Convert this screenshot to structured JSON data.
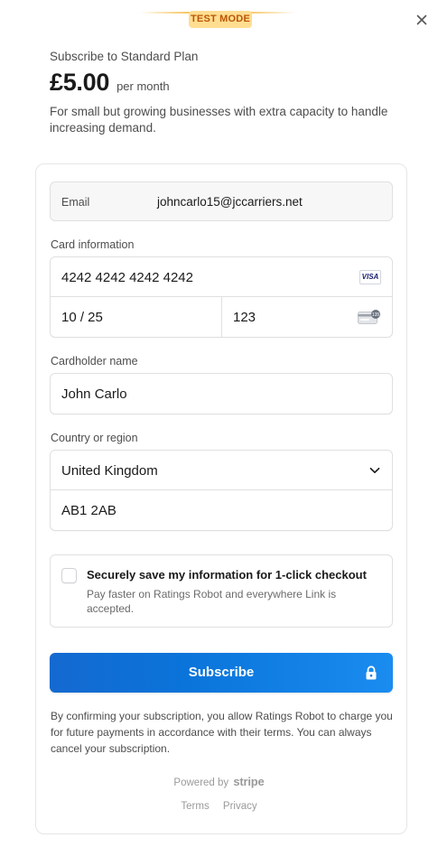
{
  "banner": {
    "test_mode": "TEST MODE"
  },
  "plan": {
    "subscribe_to": "Subscribe to Standard Plan",
    "price": "£5.00",
    "period": "per month",
    "description": "For small but growing businesses with extra capacity to handle increasing demand."
  },
  "form": {
    "email_label": "Email",
    "email_value": "johncarlo15@jccarriers.net",
    "card_info_label": "Card information",
    "card_number": "4242 4242 4242 4242",
    "card_brand": "VISA",
    "expiry": "10 / 25",
    "cvc": "123",
    "cardholder_label": "Cardholder name",
    "cardholder_value": "John Carlo",
    "country_label": "Country or region",
    "country_value": "United Kingdom",
    "postal_value": "AB1 2AB"
  },
  "save_info": {
    "title": "Securely save my information for 1-click checkout",
    "subtitle": "Pay faster on Ratings Robot and everywhere Link is accepted."
  },
  "subscribe_button": "Subscribe",
  "legal": "By confirming your subscription, you allow Ratings Robot to charge you for future payments in accordance with their terms. You can always cancel your subscription.",
  "footer": {
    "powered_by": "Powered by",
    "stripe": "stripe",
    "terms": "Terms",
    "privacy": "Privacy"
  },
  "colors": {
    "accent": "#0a74da",
    "badge_bg": "#ffde92",
    "badge_text": "#bb5504"
  },
  "icons": [
    "close-icon",
    "visa-icon",
    "cvc-card-icon",
    "chevron-down-icon",
    "lock-icon"
  ]
}
